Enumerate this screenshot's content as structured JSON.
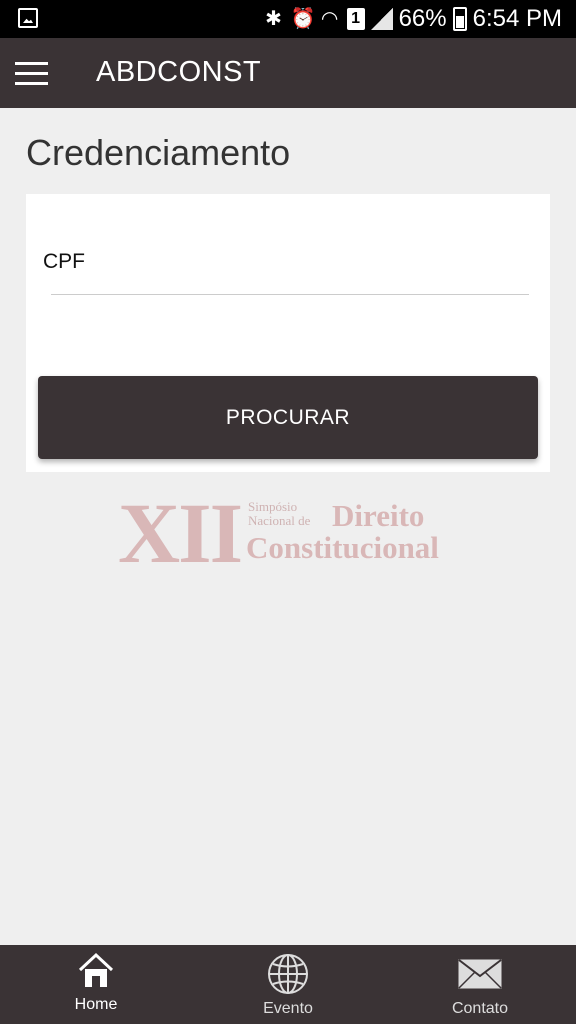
{
  "status_bar": {
    "battery_percent": "66%",
    "time": "6:54 PM",
    "sim_label": "1"
  },
  "app_bar": {
    "title": "ABDCONST"
  },
  "page": {
    "title": "Credenciamento"
  },
  "form": {
    "cpf_label": "CPF",
    "cpf_value": "",
    "search_button_label": "PROCURAR"
  },
  "logo": {
    "numeral": "XII",
    "line1": "Simpósio",
    "line2": "Nacional de",
    "word1": "Direito",
    "word2": "Constitucional"
  },
  "bottom_nav": {
    "items": [
      {
        "label": "Home",
        "icon": "home-icon"
      },
      {
        "label": "Evento",
        "icon": "globe-icon"
      },
      {
        "label": "Contato",
        "icon": "envelope-icon"
      }
    ]
  },
  "colors": {
    "primary": "#3a3335",
    "background": "#efefef",
    "logo_tint": "#d9b7b7"
  }
}
